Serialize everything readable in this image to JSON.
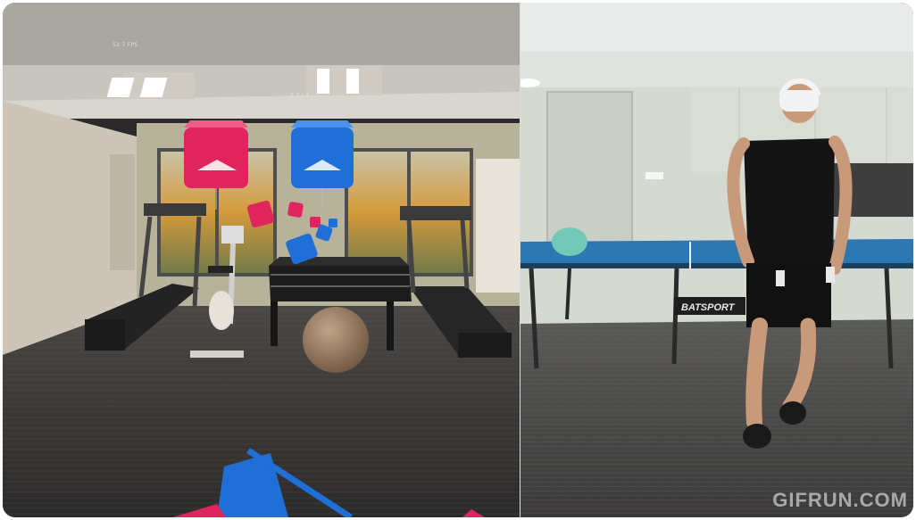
{
  "left_view": {
    "hud_top": "52.7 FPS",
    "hud_mid": "3.3 / 4"
  },
  "right_view": {
    "table_brand": "BATSPORT"
  },
  "watermark": {
    "text": "GIFRUN.COM"
  },
  "colors": {
    "cube_red": "#e0245e",
    "cube_blue": "#1f6fd6"
  }
}
